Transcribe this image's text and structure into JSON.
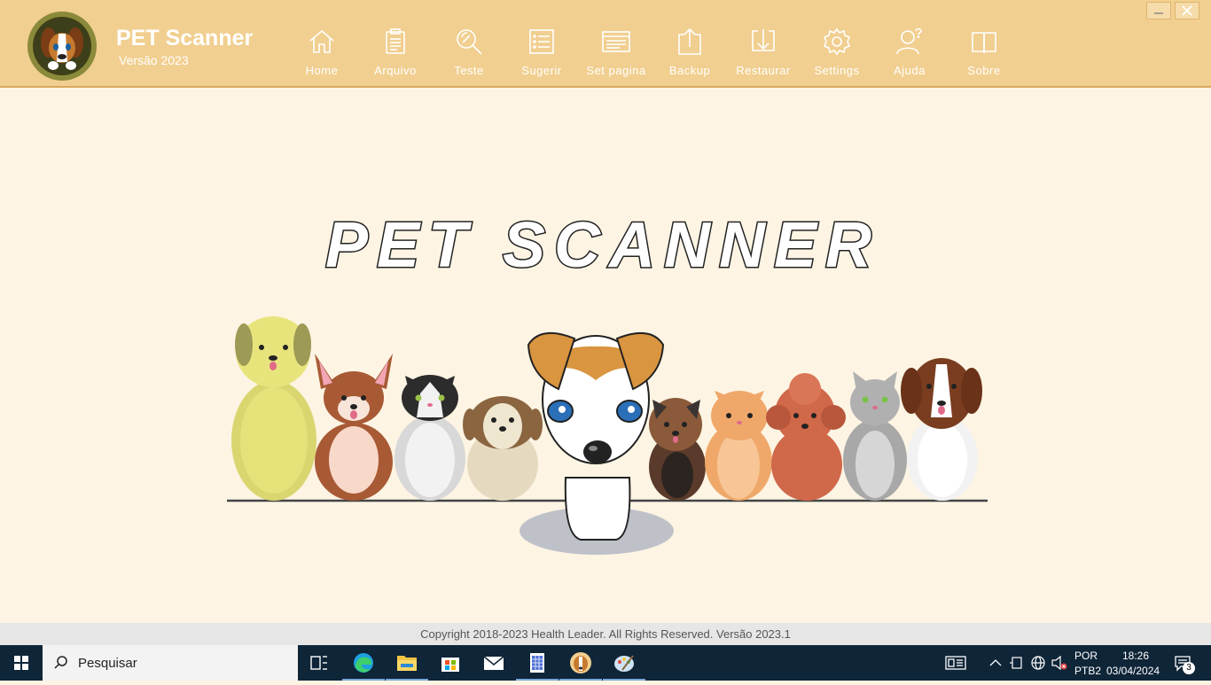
{
  "app": {
    "title": "PET Scanner",
    "version": "Versão 2023"
  },
  "nav": [
    {
      "label": "Home",
      "icon": "home-icon"
    },
    {
      "label": "Arquivo",
      "icon": "clipboard-icon"
    },
    {
      "label": "Teste",
      "icon": "magnifier-icon"
    },
    {
      "label": "Sugerir",
      "icon": "list-icon"
    },
    {
      "label": "Set pagina",
      "icon": "page-setup-icon"
    },
    {
      "label": "Backup",
      "icon": "upload-icon"
    },
    {
      "label": "Restaurar",
      "icon": "download-icon"
    },
    {
      "label": "Settings",
      "icon": "gear-icon"
    },
    {
      "label": "Ajuda",
      "icon": "help-user-icon"
    },
    {
      "label": "Sobre",
      "icon": "book-icon"
    }
  ],
  "banner": {
    "title": "PET SCANNER"
  },
  "footer": {
    "copyright": "Copyright 2018-2023 Health Leader. All Rights Reserved.  Versão 2023.1"
  },
  "taskbar": {
    "search_placeholder": "Pesquisar",
    "lang": "POR",
    "layout": "PTB2",
    "time": "18:26",
    "date": "03/04/2024",
    "notifications": "3"
  },
  "colors": {
    "header": "#f1cf90",
    "background": "#fdf4e3",
    "taskbar": "#0f2538"
  }
}
